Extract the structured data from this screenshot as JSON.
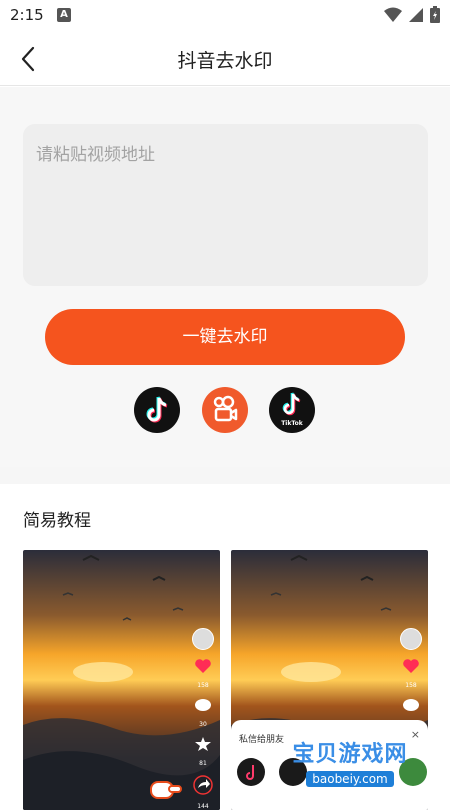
{
  "status_bar": {
    "time": "2:15",
    "notification_icon": "A"
  },
  "header": {
    "title": "抖音去水印",
    "back_icon": "chevron-left-icon"
  },
  "input": {
    "placeholder": "请粘贴视频地址",
    "value": ""
  },
  "main_button": {
    "label": "一键去水印"
  },
  "platforms": [
    {
      "name": "douyin",
      "icon": "douyin-icon"
    },
    {
      "name": "kuaishou",
      "icon": "kuaishou-icon"
    },
    {
      "name": "tiktok",
      "icon": "tiktok-icon",
      "label": "TikTok"
    }
  ],
  "tutorial": {
    "title": "简易教程",
    "left_shot": {
      "counts": [
        "158",
        "30",
        "81",
        "144"
      ]
    },
    "right_shot": {
      "counts": [
        "158",
        "30"
      ],
      "share_panel_title": "私信给朋友",
      "close": "×"
    }
  },
  "watermark": {
    "text": "宝贝游戏网",
    "url": "baobeiy.com"
  },
  "colors": {
    "accent": "#f5541e",
    "input_bg": "#eeeeee",
    "page_bg": "#f7f7f7",
    "kuaishou": "#f05a2c"
  }
}
